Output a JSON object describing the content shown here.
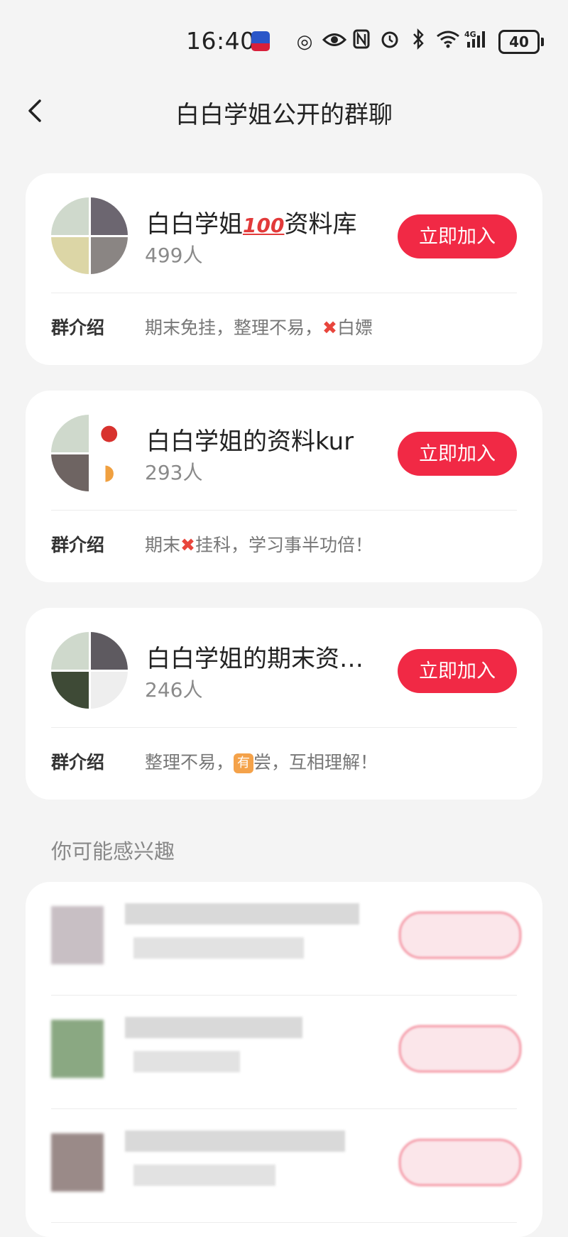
{
  "status_bar": {
    "time": "16:40",
    "battery": "40"
  },
  "header": {
    "title": "白白学姐公开的群聊"
  },
  "groups": [
    {
      "name": "白白学姐",
      "name_emoji": "100",
      "name_suffix": "资料库",
      "count": "499人",
      "join_label": "立即加入",
      "intro_label": "群介绍",
      "intro_before": "期末免挂，整理不易，",
      "intro_emoji": "✖",
      "intro_after": "白嫖"
    },
    {
      "name": "白白学姐的资料kur",
      "count": "293人",
      "join_label": "立即加入",
      "intro_label": "群介绍",
      "intro_before": "期末",
      "intro_emoji": "✖",
      "intro_after": "挂科，学习事半功倍！"
    },
    {
      "name": "白白学姐的期末资…",
      "count": "246人",
      "join_label": "立即加入",
      "intro_label": "群介绍",
      "intro_before": "整理不易，",
      "intro_emoji": "有",
      "intro_after": "尝，互相理解！"
    }
  ],
  "interest": {
    "section_title": "你可能感兴趣"
  },
  "colors": {
    "accent": "#f12945",
    "background": "#f4f4f4"
  }
}
